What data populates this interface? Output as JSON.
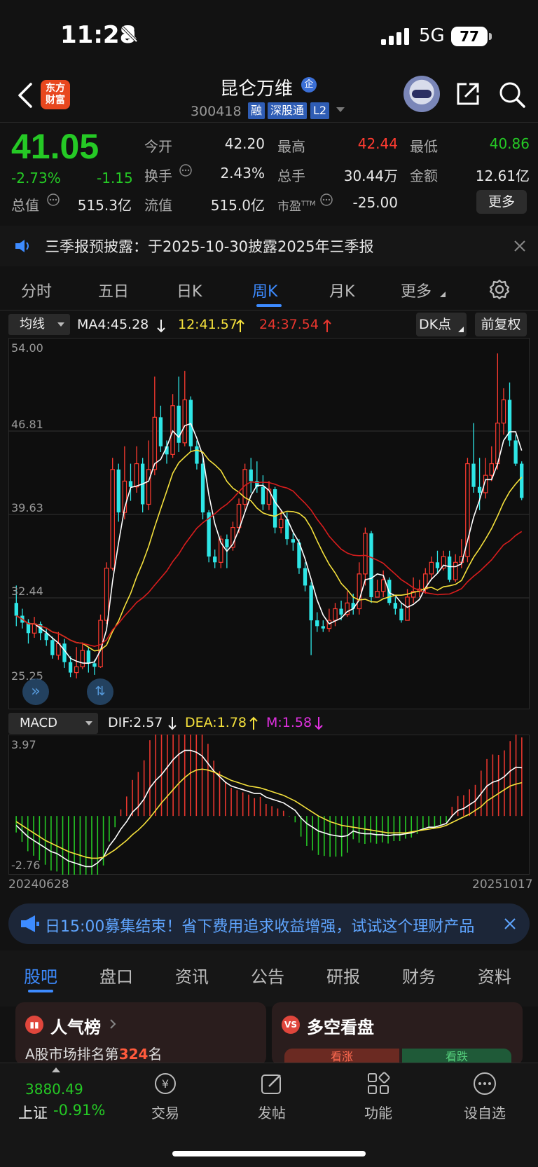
{
  "status_bar": {
    "time": "11:28",
    "network": "5G",
    "battery": "77"
  },
  "header": {
    "logo_line1": "东方",
    "logo_line2": "财富",
    "stock_name": "昆仑万维",
    "corp_badge": "企",
    "stock_code": "300418",
    "tags": [
      "融",
      "深股通",
      "L2"
    ]
  },
  "quote": {
    "price": "41.05",
    "change_pct": "-2.73%",
    "change_abs": "-1.15",
    "fields": [
      {
        "label": "今开",
        "value": "42.20"
      },
      {
        "label": "最高",
        "value": "42.44"
      },
      {
        "label": "最低",
        "value": "40.86"
      },
      {
        "label": "换手",
        "value": "2.43%"
      },
      {
        "label": "总手",
        "value": "30.44万"
      },
      {
        "label": "金额",
        "value": "12.61亿"
      },
      {
        "label": "总值",
        "value": "515.3亿"
      },
      {
        "label": "流值",
        "value": "515.0亿"
      },
      {
        "label": "市盈",
        "label_sup": "TTM",
        "value": "-25.00"
      }
    ],
    "more_label": "更多",
    "colors": {
      "up": "#ff3b30",
      "down": "#25c925"
    }
  },
  "notice": {
    "text": "三季报预披露：于2025-10-30披露2025年三季报"
  },
  "period_tabs": [
    "分时",
    "五日",
    "日K",
    "周K",
    "月K",
    "更多"
  ],
  "active_period": "周K",
  "chart_header": {
    "indicator_select": "均线",
    "ma4": "MA4:45.28",
    "ma12": "12:41.57",
    "ma24": "24:37.54",
    "dk_label": "DK点",
    "adjust_label": "前复权"
  },
  "macd_header": {
    "indicator_select": "MACD",
    "dif": "DIF:2.57",
    "dea": "DEA:1.78",
    "m": "M:1.58"
  },
  "chart_data": [
    {
      "type": "candlestick",
      "y_ticks": [
        "54.00",
        "46.81",
        "39.63",
        "32.44",
        "25.25"
      ],
      "ylim": [
        25.25,
        54.0
      ],
      "start_date": "20240628",
      "end_date": "20251017",
      "series_colors": {
        "ma4": "#ffffff",
        "ma12": "#f5e13c",
        "ma24": "#d81d1d"
      },
      "candles": [
        [
          32.0,
          30.9,
          33.5,
          30.0
        ],
        [
          30.9,
          30.3,
          31.5,
          29.8
        ],
        [
          30.3,
          29.4,
          30.6,
          28.5
        ],
        [
          29.4,
          30.2,
          30.8,
          29.0
        ],
        [
          30.2,
          29.4,
          30.4,
          28.8
        ],
        [
          29.4,
          28.8,
          29.8,
          28.3
        ],
        [
          28.8,
          27.5,
          29.1,
          27.2
        ],
        [
          27.5,
          28.5,
          29.5,
          27.1
        ],
        [
          28.5,
          26.9,
          28.9,
          26.4
        ],
        [
          26.9,
          26.0,
          27.4,
          25.6
        ],
        [
          26.0,
          26.5,
          28.2,
          25.5
        ],
        [
          26.5,
          27.9,
          28.6,
          26.3
        ],
        [
          27.9,
          26.8,
          28.2,
          26.0
        ],
        [
          26.8,
          26.5,
          27.1,
          25.8
        ],
        [
          26.5,
          30.5,
          31.0,
          26.4
        ],
        [
          30.5,
          35.0,
          35.5,
          30.2
        ],
        [
          35.0,
          43.5,
          44.5,
          34.8
        ],
        [
          43.5,
          39.8,
          44.0,
          39.0
        ],
        [
          39.8,
          42.5,
          45.5,
          39.2
        ],
        [
          42.5,
          42.0,
          44.0,
          40.8
        ],
        [
          42.0,
          44.0,
          45.5,
          41.5
        ],
        [
          44.0,
          40.5,
          44.5,
          39.8
        ],
        [
          40.5,
          43.5,
          46.0,
          40.0
        ],
        [
          43.5,
          48.0,
          51.5,
          43.0
        ],
        [
          48.0,
          45.5,
          49.0,
          45.0
        ],
        [
          45.5,
          44.8,
          46.0,
          44.0
        ],
        [
          44.8,
          49.0,
          50.0,
          44.5
        ],
        [
          49.0,
          45.8,
          51.5,
          45.0
        ],
        [
          45.8,
          49.5,
          52.0,
          45.5
        ],
        [
          49.5,
          45.5,
          49.8,
          45.0
        ],
        [
          45.5,
          44.0,
          46.0,
          43.5
        ],
        [
          44.0,
          39.8,
          44.5,
          39.2
        ],
        [
          39.8,
          36.0,
          40.0,
          35.5
        ],
        [
          36.0,
          35.5,
          36.6,
          35.0
        ],
        [
          35.5,
          37.5,
          37.8,
          35.0
        ],
        [
          37.5,
          36.8,
          37.9,
          35.0
        ],
        [
          36.8,
          38.5,
          39.0,
          36.5
        ],
        [
          38.5,
          40.5,
          41.0,
          38.0
        ],
        [
          40.5,
          43.5,
          44.0,
          40.0
        ],
        [
          43.5,
          42.5,
          44.5,
          41.5
        ],
        [
          42.5,
          42.0,
          44.2,
          41.5
        ],
        [
          42.0,
          40.5,
          43.0,
          40.0
        ],
        [
          40.5,
          41.8,
          42.5,
          40.0
        ],
        [
          41.8,
          38.5,
          42.0,
          38.0
        ],
        [
          38.5,
          39.2,
          40.0,
          38.0
        ],
        [
          39.2,
          37.5,
          39.8,
          37.0
        ],
        [
          37.5,
          37.2,
          38.0,
          36.5
        ],
        [
          37.2,
          35.0,
          37.5,
          34.5
        ],
        [
          35.0,
          33.5,
          35.5,
          33.0
        ],
        [
          33.5,
          30.5,
          33.8,
          27.5
        ],
        [
          30.5,
          30.0,
          31.2,
          29.5
        ],
        [
          30.0,
          29.8,
          30.5,
          29.5
        ],
        [
          29.8,
          30.5,
          31.5,
          29.5
        ],
        [
          30.5,
          31.5,
          32.0,
          30.0
        ],
        [
          31.5,
          31.0,
          32.2,
          30.5
        ],
        [
          31.0,
          32.0,
          33.0,
          30.8
        ],
        [
          32.0,
          31.5,
          32.8,
          31.0
        ],
        [
          31.5,
          34.5,
          35.5,
          31.0
        ],
        [
          34.5,
          38.0,
          38.5,
          33.5
        ],
        [
          38.0,
          32.5,
          38.2,
          32.0
        ],
        [
          32.5,
          33.0,
          34.0,
          32.5
        ],
        [
          33.0,
          34.0,
          34.8,
          32.5
        ],
        [
          34.0,
          32.0,
          34.2,
          31.8
        ],
        [
          32.0,
          31.5,
          32.5,
          31.0
        ],
        [
          31.5,
          30.5,
          32.0,
          30.3
        ],
        [
          30.5,
          32.5,
          33.2,
          30.5
        ],
        [
          32.5,
          33.0,
          34.2,
          32.0
        ],
        [
          33.0,
          33.2,
          34.0,
          32.5
        ],
        [
          33.2,
          34.5,
          35.0,
          32.8
        ],
        [
          34.5,
          35.5,
          36.0,
          34.0
        ],
        [
          35.5,
          35.0,
          36.5,
          34.5
        ],
        [
          35.0,
          36.0,
          36.5,
          34.8
        ],
        [
          36.0,
          34.0,
          36.5,
          33.8
        ],
        [
          34.0,
          35.5,
          36.2,
          33.8
        ],
        [
          35.5,
          36.0,
          37.5,
          35.0
        ],
        [
          36.0,
          44.0,
          44.5,
          35.5
        ],
        [
          44.0,
          42.0,
          47.5,
          41.5
        ],
        [
          42.0,
          41.5,
          44.5,
          40.0
        ],
        [
          41.5,
          43.0,
          44.5,
          41.0
        ],
        [
          43.0,
          44.0,
          45.5,
          42.5
        ],
        [
          44.0,
          47.5,
          53.5,
          43.5
        ],
        [
          47.5,
          49.5,
          50.5,
          46.5
        ],
        [
          49.5,
          46.0,
          51.0,
          45.5
        ],
        [
          46.0,
          44.0,
          46.5,
          43.8
        ],
        [
          44.0,
          41.05,
          44.2,
          40.86
        ]
      ]
    },
    {
      "type": "bar",
      "title": "MACD",
      "y_ticks": [
        "3.97",
        "-2.76"
      ],
      "ylim": [
        -2.76,
        3.97
      ],
      "series_colors": {
        "dif": "#ffffff",
        "dea": "#f5e13c",
        "m_up": "#e8362e",
        "m_down": "#25c925"
      },
      "dif": [
        -0.5,
        -0.8,
        -1.1,
        -1.3,
        -1.5,
        -1.7,
        -1.9,
        -2.0,
        -2.2,
        -2.4,
        -2.5,
        -2.6,
        -2.7,
        -2.7,
        -2.5,
        -2.2,
        -1.6,
        -1.2,
        -0.7,
        -0.3,
        0.2,
        0.5,
        0.9,
        1.5,
        1.9,
        2.2,
        2.6,
        3.0,
        3.3,
        3.5,
        3.5,
        3.4,
        3.2,
        2.8,
        2.4,
        2.1,
        1.8,
        1.6,
        1.5,
        1.4,
        1.3,
        1.2,
        1.2,
        1.0,
        0.9,
        0.8,
        0.7,
        0.5,
        0.3,
        -0.1,
        -0.4,
        -0.6,
        -0.8,
        -0.9,
        -1.0,
        -1.05,
        -1.1,
        -1.05,
        -0.8,
        -0.9,
        -0.95,
        -0.95,
        -1.0,
        -1.0,
        -1.05,
        -1.0,
        -1.0,
        -0.95,
        -0.9,
        -0.8,
        -0.7,
        -0.6,
        -0.6,
        -0.5,
        -0.4,
        0.0,
        0.3,
        0.4,
        0.6,
        0.8,
        1.2,
        1.6,
        1.8,
        1.9,
        2.1,
        2.4,
        2.6,
        2.57
      ],
      "dea": [
        -0.3,
        -0.5,
        -0.7,
        -0.9,
        -1.1,
        -1.3,
        -1.45,
        -1.6,
        -1.75,
        -1.9,
        -2.0,
        -2.1,
        -2.2,
        -2.25,
        -2.25,
        -2.2,
        -2.0,
        -1.8,
        -1.55,
        -1.3,
        -1.0,
        -0.75,
        -0.45,
        -0.1,
        0.3,
        0.7,
        1.05,
        1.4,
        1.75,
        2.05,
        2.3,
        2.45,
        2.5,
        2.45,
        2.35,
        2.2,
        2.05,
        1.9,
        1.8,
        1.7,
        1.6,
        1.55,
        1.5,
        1.4,
        1.3,
        1.2,
        1.1,
        0.95,
        0.8,
        0.6,
        0.4,
        0.2,
        0.0,
        -0.15,
        -0.3,
        -0.4,
        -0.5,
        -0.55,
        -0.6,
        -0.65,
        -0.7,
        -0.75,
        -0.8,
        -0.85,
        -0.9,
        -0.9,
        -0.9,
        -0.9,
        -0.85,
        -0.8,
        -0.75,
        -0.7,
        -0.65,
        -0.6,
        -0.5,
        -0.35,
        -0.2,
        -0.05,
        0.1,
        0.3,
        0.5,
        0.8,
        1.0,
        1.2,
        1.4,
        1.6,
        1.7,
        1.78
      ]
    }
  ],
  "axis_dates": {
    "start": "20240628",
    "end": "20251017"
  },
  "ad_banner": {
    "text": "日15:00募集结束！省下费用追求收益增强，试试这个理财产品"
  },
  "bottom_tabs": [
    "股吧",
    "盘口",
    "资讯",
    "公告",
    "研报",
    "财务",
    "资料"
  ],
  "active_bottom_tab": "股吧",
  "cards": {
    "rank": {
      "title": "人气榜",
      "subtitle_prefix": "A股市场排名第",
      "rank_value": "324",
      "subtitle_suffix": "名"
    },
    "longshort": {
      "title": "多空看盘",
      "up_label": "看涨",
      "down_label": "看跌"
    }
  },
  "bottom_nav": {
    "index_value": "3880.49",
    "index_name": "上证",
    "index_change": "-0.91%",
    "items": [
      "交易",
      "发帖",
      "功能",
      "设自选"
    ]
  }
}
